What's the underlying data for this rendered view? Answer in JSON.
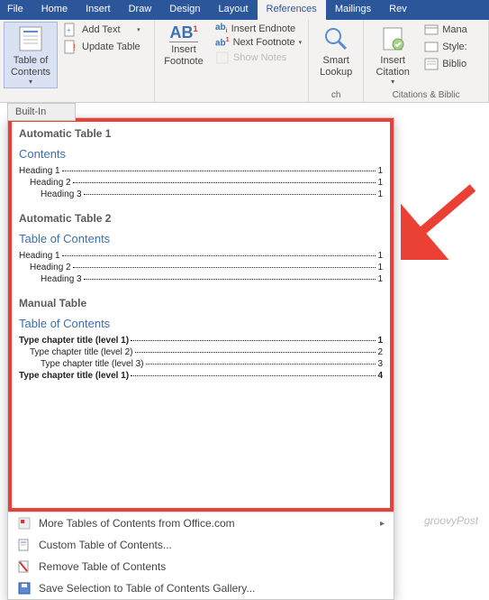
{
  "tabs": [
    "File",
    "Home",
    "Insert",
    "Draw",
    "Design",
    "Layout",
    "References",
    "Mailings",
    "Rev"
  ],
  "activeTab": "References",
  "ribbon": {
    "toc": {
      "label": "Table of\nContents",
      "addText": "Add Text",
      "updateTable": "Update Table"
    },
    "footnotes": {
      "insertFootnote": "Insert\nFootnote",
      "insertEndnote": "Insert Endnote",
      "nextFootnote": "Next Footnote",
      "showNotes": "Show Notes",
      "ab": "AB",
      "one": "1"
    },
    "smartLookup": "Smart\nLookup",
    "research": "ch",
    "citations": {
      "insertCitation": "Insert\nCitation",
      "manage": "Mana",
      "style": "Style:",
      "biblio": "Biblio",
      "groupLabel": "Citations & Biblic"
    }
  },
  "builtIn": "Built-In",
  "styles": [
    {
      "name": "Automatic Table 1",
      "tocTitle": "Contents",
      "rows": [
        {
          "label": "Heading 1",
          "page": "1",
          "indent": 0
        },
        {
          "label": "Heading 2",
          "page": "1",
          "indent": 1
        },
        {
          "label": "Heading 3",
          "page": "1",
          "indent": 2
        }
      ]
    },
    {
      "name": "Automatic Table 2",
      "tocTitle": "Table of Contents",
      "rows": [
        {
          "label": "Heading 1",
          "page": "1",
          "indent": 0
        },
        {
          "label": "Heading 2",
          "page": "1",
          "indent": 1
        },
        {
          "label": "Heading 3",
          "page": "1",
          "indent": 2
        }
      ]
    },
    {
      "name": "Manual Table",
      "tocTitle": "Table of Contents",
      "rows": [
        {
          "label": "Type chapter title (level 1)",
          "page": "1",
          "indent": 0,
          "bold": true
        },
        {
          "label": "Type chapter title (level 2)",
          "page": "2",
          "indent": 1
        },
        {
          "label": "Type chapter title (level 3)",
          "page": "3",
          "indent": 2
        },
        {
          "label": "Type chapter title (level 1)",
          "page": "4",
          "indent": 0,
          "bold": true
        }
      ]
    }
  ],
  "menu": {
    "more": "More Tables of Contents from Office.com",
    "custom": "Custom Table of Contents...",
    "remove": "Remove Table of Contents",
    "save": "Save Selection to Table of Contents Gallery..."
  },
  "watermark": "groovyPost"
}
